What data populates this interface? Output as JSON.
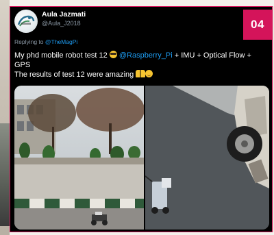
{
  "tweet": {
    "display_name": "Aula Jazmati",
    "handle": "@Aula_J2018",
    "replying_prefix": "Replying to",
    "replying_to": "@TheMagPi",
    "text_part1": "My phd mobile robot test 12",
    "mention": "@Raspberry_Pi",
    "text_part2": "+ IMU + Optical Flow + GPS",
    "text_line2": "The results of test 12 were amazing",
    "emoji_icons": [
      "smiling-face-with-sunglasses-icon",
      "raised-hands-icon",
      "relieved-face-icon"
    ]
  },
  "issue_badge": "04",
  "colors": {
    "accent": "#d4145a",
    "link": "#1d9bf0",
    "muted": "#8b98a5",
    "card_bg": "#000000"
  }
}
